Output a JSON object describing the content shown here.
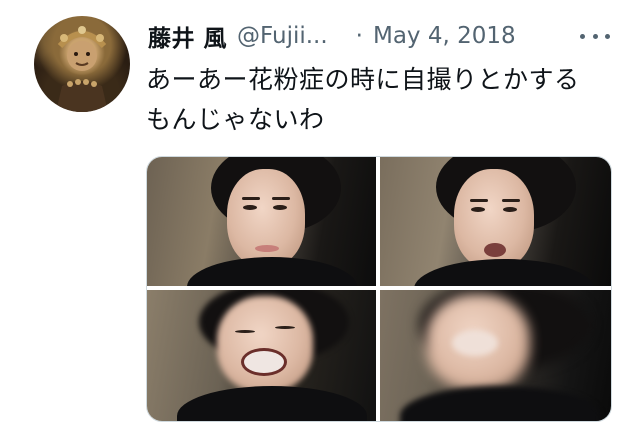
{
  "tweet": {
    "display_name": "藤井 風",
    "handle": "@Fujii...",
    "separator": "·",
    "date": "May 4, 2018",
    "text_lines": [
      "あーあー花粉症の時に自撮りとかする",
      "もんじゃないわ"
    ]
  },
  "icons": {
    "more": "more-horizontal-icon"
  },
  "colors": {
    "text_primary": "#0f1419",
    "text_secondary": "#536471",
    "border": "#cfd9de",
    "background": "#ffffff"
  }
}
